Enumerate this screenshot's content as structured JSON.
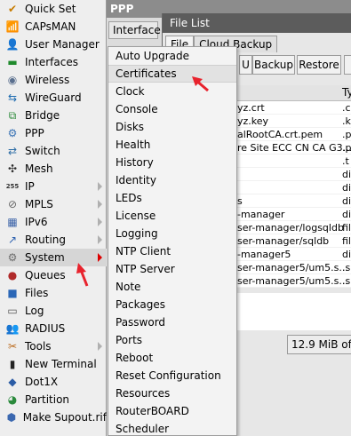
{
  "left_menu": {
    "items": [
      {
        "label": "Quick Set",
        "icon": "quick-set-icon",
        "glyph": "✔",
        "color": "#c77b00",
        "has_submenu": false
      },
      {
        "label": "CAPsMAN",
        "icon": "capsman-icon",
        "glyph": "📶",
        "color": "#4d6a92",
        "has_submenu": false
      },
      {
        "label": "User Manager",
        "icon": "user-manager-icon",
        "glyph": "👤",
        "color": "#3e69b0",
        "has_submenu": false
      },
      {
        "label": "Interfaces",
        "icon": "interfaces-icon",
        "glyph": "▬",
        "color": "#1f8a2c",
        "has_submenu": false
      },
      {
        "label": "Wireless",
        "icon": "wireless-icon",
        "glyph": "◉",
        "color": "#5a6f8e",
        "has_submenu": false
      },
      {
        "label": "WireGuard",
        "icon": "wireguard-icon",
        "glyph": "⇆",
        "color": "#1e6bb0",
        "has_submenu": false
      },
      {
        "label": "Bridge",
        "icon": "bridge-icon",
        "glyph": "⧉",
        "color": "#2d8a3a",
        "has_submenu": false
      },
      {
        "label": "PPP",
        "icon": "ppp-icon",
        "glyph": "⚙",
        "color": "#3a73b5",
        "has_submenu": false
      },
      {
        "label": "Switch",
        "icon": "switch-icon",
        "glyph": "⇄",
        "color": "#2f6ea6",
        "has_submenu": false
      },
      {
        "label": "Mesh",
        "icon": "mesh-icon",
        "glyph": "✣",
        "color": "#2c2c2c",
        "has_submenu": false
      },
      {
        "label": "IP",
        "icon": "ip-icon",
        "glyph": "255",
        "color": "#333333",
        "has_submenu": true
      },
      {
        "label": "MPLS",
        "icon": "mpls-icon",
        "glyph": "⊘",
        "color": "#666666",
        "has_submenu": true
      },
      {
        "label": "IPv6",
        "icon": "ipv6-icon",
        "glyph": "▦",
        "color": "#3a62a8",
        "has_submenu": true
      },
      {
        "label": "Routing",
        "icon": "routing-icon",
        "glyph": "↗",
        "color": "#2a5fae",
        "has_submenu": true
      },
      {
        "label": "System",
        "icon": "system-icon",
        "glyph": "⚙",
        "color": "#6d6d6d",
        "has_submenu": true
      },
      {
        "label": "Queues",
        "icon": "queues-icon",
        "glyph": "●",
        "color": "#b02a2a",
        "has_submenu": false
      },
      {
        "label": "Files",
        "icon": "files-icon",
        "glyph": "■",
        "color": "#2b67b7",
        "has_submenu": false
      },
      {
        "label": "Log",
        "icon": "log-icon",
        "glyph": "▭",
        "color": "#555555",
        "has_submenu": false
      },
      {
        "label": "RADIUS",
        "icon": "radius-icon",
        "glyph": "👥",
        "color": "#3e6db0",
        "has_submenu": false
      },
      {
        "label": "Tools",
        "icon": "tools-icon",
        "glyph": "✂",
        "color": "#bb6a1b",
        "has_submenu": true
      },
      {
        "label": "New Terminal",
        "icon": "terminal-icon",
        "glyph": "▮",
        "color": "#222222",
        "has_submenu": false
      },
      {
        "label": "Dot1X",
        "icon": "dot1x-icon",
        "glyph": "◆",
        "color": "#2b5ca5",
        "has_submenu": false
      },
      {
        "label": "Partition",
        "icon": "partition-icon",
        "glyph": "◕",
        "color": "#2a8a3c",
        "has_submenu": false
      },
      {
        "label": "Make Supout.rif",
        "icon": "supout-icon",
        "glyph": "⬢",
        "color": "#3b68b0",
        "has_submenu": false
      }
    ],
    "selected_item": "System"
  },
  "ppp_window": {
    "title": "PPP",
    "tab_label": "Interface"
  },
  "file_list_window": {
    "title": "File List",
    "tabs": [
      "File",
      "Cloud Backup"
    ],
    "toolbar": {
      "backup_label": "Backup",
      "restore_label": "Restore",
      "extra_label": "U"
    },
    "type_column_header": "Ty",
    "rows": [
      {
        "name": "yz.crt",
        "type": ".c"
      },
      {
        "name": "yz.key",
        "type": ".k"
      },
      {
        "name": "alRootCA.crt.pem",
        "type": ".p"
      },
      {
        "name": "re Site ECC CN CA G3...",
        "type": ".p"
      },
      {
        "name": "",
        "type": ".t"
      },
      {
        "name": "",
        "type": "di"
      },
      {
        "name": "",
        "type": "di"
      },
      {
        "name": "s",
        "type": "di"
      },
      {
        "name": "-manager",
        "type": "di"
      },
      {
        "name": "ser-manager/logsqldb",
        "type": "fil"
      },
      {
        "name": "ser-manager/sqldb",
        "type": "fil"
      },
      {
        "name": "-manager5",
        "type": "di"
      },
      {
        "name": "ser-manager5/um5.s...",
        "type": ".s"
      },
      {
        "name": "ser-manager5/um5.s...",
        "type": ".s"
      }
    ],
    "status_text": "12.9 MiB of 16"
  },
  "system_submenu": {
    "items": [
      "Auto Upgrade",
      "Certificates",
      "Clock",
      "Console",
      "Disks",
      "Health",
      "History",
      "Identity",
      "LEDs",
      "License",
      "Logging",
      "NTP Client",
      "NTP Server",
      "Note",
      "Packages",
      "Password",
      "Ports",
      "Reboot",
      "Reset Configuration",
      "Resources",
      "RouterBOARD",
      "Scheduler"
    ],
    "hovered_item": "Certificates"
  },
  "colors": {
    "annotation_red": "#e8232d",
    "menu_background": "#eeeeee",
    "file_titlebar": "#5c5c5c"
  }
}
